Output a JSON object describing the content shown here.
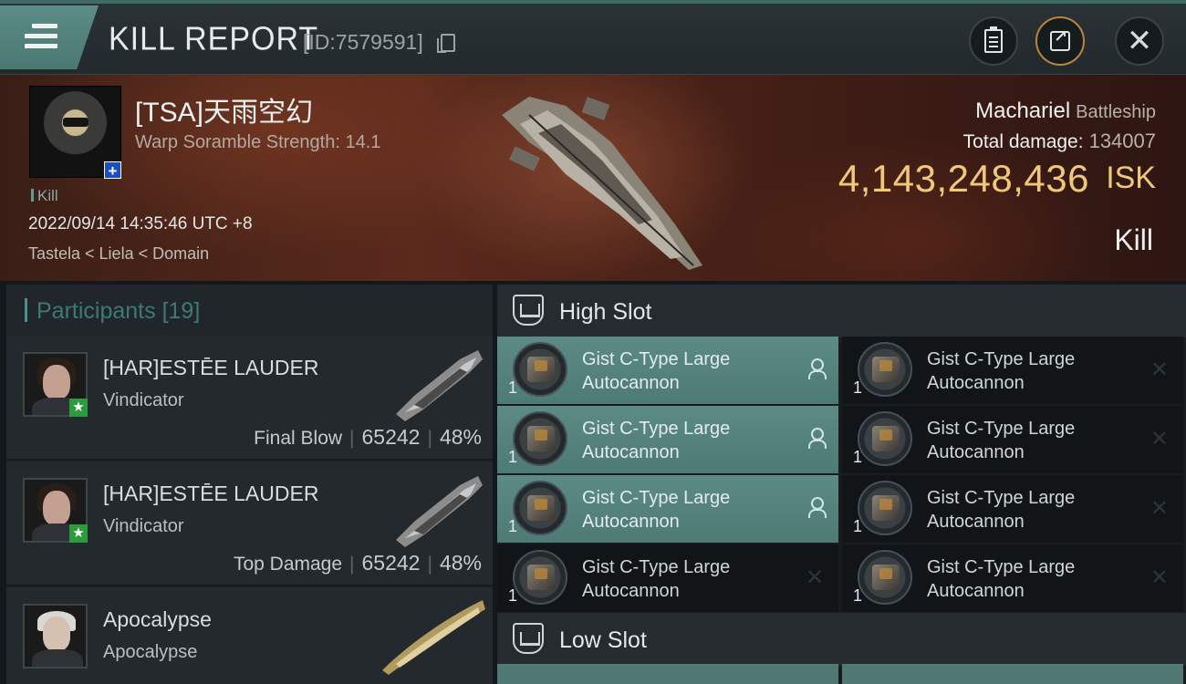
{
  "header": {
    "title": "KILL REPORT",
    "report_id": "[ID:7579591]",
    "menu_icon": "hamburger-menu-icon",
    "clipboard_icon": "clipboard-icon",
    "share_icon": "share-icon",
    "close_icon": "close-icon"
  },
  "victim": {
    "name": "[TSA]天雨空幻",
    "warp_scramble": "Warp Soramble Strength: 14.1",
    "tag": "Kill",
    "datetime": "2022/09/14 14:35:46 UTC +8",
    "location": "Tastela < Liela < Domain",
    "ship": "Machariel",
    "ship_class": "Battleship",
    "total_damage_label": "Total damage:",
    "total_damage": "134007",
    "isk_value": "4,143,248,436",
    "isk_unit": "ISK",
    "result": "Kill"
  },
  "participants": {
    "title": "Participants",
    "count": "[19]",
    "items": [
      {
        "name": "[HAR]ESTĒE LAUDER",
        "ship": "Vindicator",
        "role": "Final Blow",
        "damage": "65242",
        "percent": "48%"
      },
      {
        "name": "[HAR]ESTĒE LAUDER",
        "ship": "Vindicator",
        "role": "Top Damage",
        "damage": "65242",
        "percent": "48%"
      },
      {
        "name": "Apocalypse",
        "ship": "Apocalypse",
        "role": "",
        "damage": "",
        "percent": ""
      }
    ]
  },
  "slots": {
    "high_title": "High Slot",
    "low_title": "Low Slot",
    "module_name_line1": "Gist C-Type Large",
    "module_name_line2": "Autocannon",
    "qty": "1",
    "high_modules": [
      {
        "active": true
      },
      {
        "active": false
      },
      {
        "active": true
      },
      {
        "active": false
      },
      {
        "active": true
      },
      {
        "active": false
      },
      {
        "active": false
      },
      {
        "active": false
      }
    ],
    "status_destroyed_symbol": "✕"
  },
  "colors": {
    "accent_teal": "#5c8a84",
    "isk_gold": "#f0c878",
    "participants_title": "#3d7a74"
  }
}
